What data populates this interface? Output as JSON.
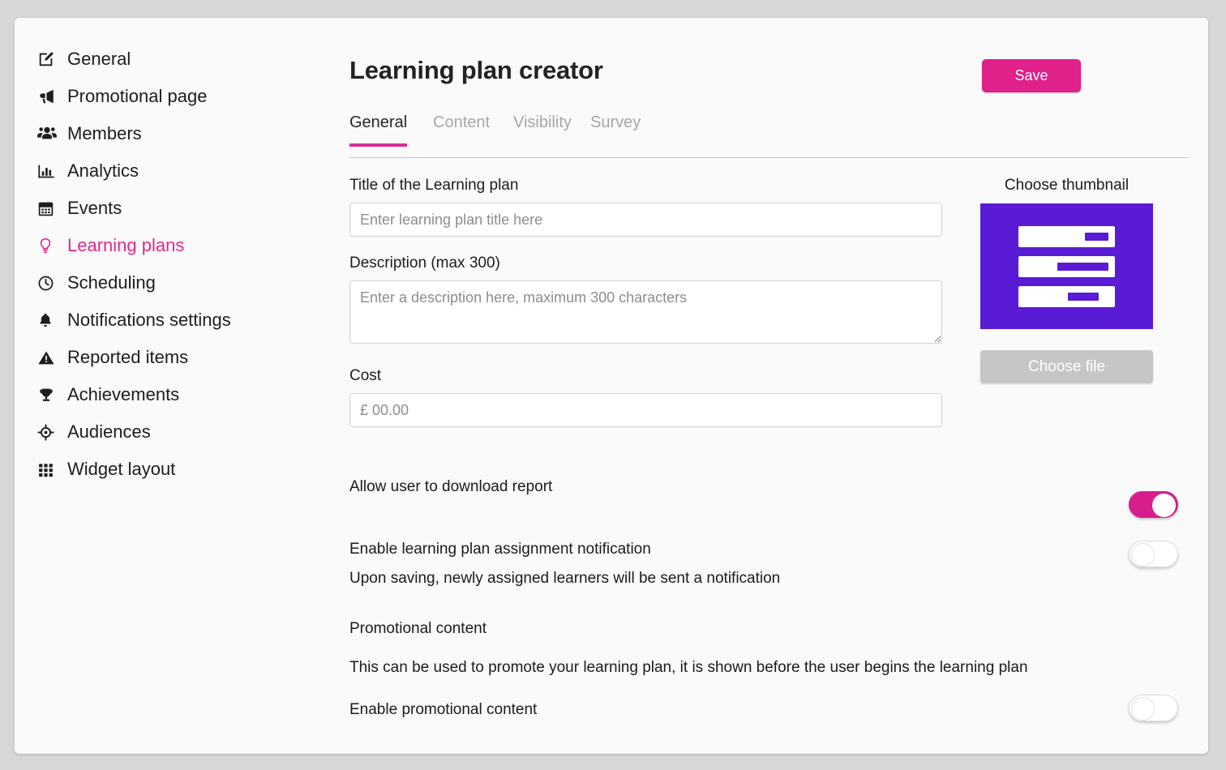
{
  "sidebar": {
    "items": [
      {
        "label": "General",
        "icon": "edit-square-icon",
        "active": false
      },
      {
        "label": "Promotional page",
        "icon": "megaphone-icon",
        "active": false
      },
      {
        "label": "Members",
        "icon": "users-icon",
        "active": false
      },
      {
        "label": "Analytics",
        "icon": "bar-chart-icon",
        "active": false
      },
      {
        "label": "Events",
        "icon": "calendar-icon",
        "active": false
      },
      {
        "label": "Learning plans",
        "icon": "lightbulb-icon",
        "active": true
      },
      {
        "label": "Scheduling",
        "icon": "clock-icon",
        "active": false
      },
      {
        "label": "Notifications settings",
        "icon": "bell-icon",
        "active": false
      },
      {
        "label": "Reported items",
        "icon": "warning-triangle-icon",
        "active": false
      },
      {
        "label": "Achievements",
        "icon": "trophy-icon",
        "active": false
      },
      {
        "label": "Audiences",
        "icon": "crosshair-icon",
        "active": false
      },
      {
        "label": "Widget layout",
        "icon": "grid-icon",
        "active": false
      }
    ]
  },
  "header": {
    "title": "Learning plan creator",
    "save_label": "Save"
  },
  "tabs": [
    {
      "label": "General",
      "active": true
    },
    {
      "label": "Content",
      "active": false
    },
    {
      "label": "Visibility",
      "active": false
    },
    {
      "label": "Survey",
      "active": false
    }
  ],
  "form": {
    "title_label": "Title of the Learning plan",
    "title_value": "",
    "title_placeholder": "Enter learning plan title here",
    "description_label": "Description (max 300)",
    "description_value": "",
    "description_placeholder": "Enter a description here, maximum 300 characters",
    "cost_label": "Cost",
    "cost_value": "",
    "cost_placeholder": "£ 00.00"
  },
  "settings": {
    "allow_download_report": {
      "label": "Allow user to download report",
      "state": "on"
    },
    "assignment_notification": {
      "label": "Enable learning plan assignment notification",
      "sub": "Upon saving, newly assigned learners will be sent a notification",
      "state": "off"
    },
    "promotional_content": {
      "heading": "Promotional content",
      "description": "This can be used to promote your learning plan, it is shown before the user begins the learning plan",
      "enable_label": "Enable promotional content",
      "state": "off"
    }
  },
  "thumbnail": {
    "caption": "Choose thumbnail",
    "choose_file_label": "Choose file",
    "image_color": "#5A1BD4"
  },
  "colors": {
    "accent_pink": "#E0218A",
    "active_nav": "#E02A8E",
    "toggle_on": "#D81E8D",
    "thumbnail_purple": "#5A1BD4",
    "page_background": "#D7D7D7",
    "card_background": "#FAFAFA"
  }
}
